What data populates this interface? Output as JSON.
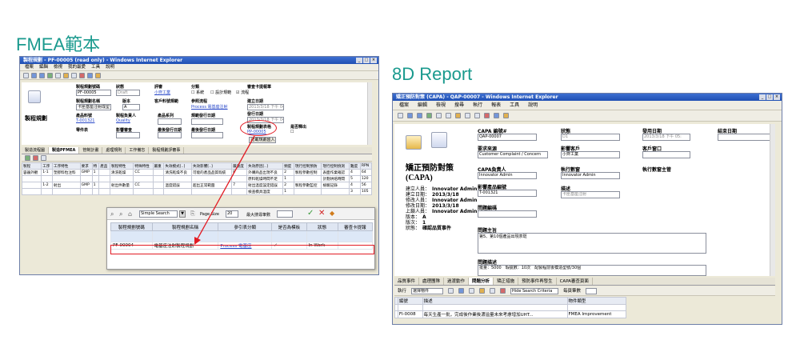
{
  "headings": {
    "left": "FMEA範本",
    "right": "8D Report"
  },
  "fmea": {
    "window_title": "製程規劃 - PF-00005 (read only) - Windows Internet Explorer",
    "menu": [
      "檔案",
      "編輯",
      "檢視",
      "我的最愛",
      "工具",
      "說明"
    ],
    "form_title": "製程規劃",
    "fields": {
      "plan_no_label": "製程規劃號碼",
      "plan_no": "PF-00005",
      "status_label": "狀態",
      "status": "Draft",
      "review_label": "評審",
      "review": "小齊工業",
      "type_label": "分類",
      "type_opts": [
        "系統",
        "設計規範",
        "流程"
      ],
      "review_date_label": "審查卡提報單",
      "plan_name_label": "製程規劃名稱",
      "plan_name": "卡匣基座注射成型",
      "version_label": "版本",
      "version": "A",
      "cust_label": "客戶料號規範",
      "process_label": "參照流程",
      "process": "Process 電基座注射",
      "created_label": "建立日期",
      "created": "2013/3/18 下午 04:31",
      "part_no_label": "產品料號",
      "part_no": "T-001321",
      "owner_label": "製程負責人",
      "owner": "Quality",
      "product_label": "產品系列",
      "approved_label": "規範發行日期",
      "approver_label": "發行日期",
      "approver": "2013/3/18 下午 04:31",
      "partner_label": "零件表",
      "impact_label": "影響審查",
      "revision_label": "最後發行日期",
      "sheet_label": "製程規劃表格",
      "sheet_link": "PP-00005",
      "evaluate_label": "是否釋出",
      "button": "記載規劃匯入"
    },
    "tabs": [
      "製造流程圖",
      "製造PFMEA",
      "管制計畫",
      "處理規則",
      "工作備忘",
      "製程規劃評審事"
    ],
    "table": {
      "headers": [
        "製程",
        "工序",
        "工序特性",
        "要求",
        "特",
        "產品",
        "製程特性",
        "特殊特性",
        "嚴重",
        "失效模式[..]",
        "失效影響[..]",
        "嚴重度",
        "失效原因[..]",
        "頻度",
        "現行控制預防",
        "現行控制偵測",
        "難度",
        "RPN"
      ],
      "rows": [
        [
          "容器外觀",
          "1-1",
          "塑膠料粒注料",
          "GMP",
          "1",
          "",
          "清洗乾燥",
          "CC",
          "",
          "清洗乾燥不良",
          "可能的產品品質瑕疵",
          "8",
          "外購商品出現不良",
          "2",
          "製程參數控制",
          "表面作業確認",
          "4",
          "64"
        ],
        [
          "",
          "",
          "",
          "",
          "",
          "",
          "",
          "",
          "",
          "",
          "",
          "",
          "原料乾燥時間不足",
          "1",
          "",
          "計劃烘焙時間",
          "5",
          "120"
        ],
        [
          "",
          "1-2",
          "射出",
          "GMP",
          "1",
          "",
          "射出件數量",
          "CC",
          "",
          "溫度錯誤",
          "超出正常範圍",
          "7",
          "射出溫度設定錯誤",
          "2",
          "製程參數監控",
          "檢驗記錄",
          "4",
          "56"
        ],
        [
          "",
          "",
          "",
          "",
          "",
          "",
          "",
          "",
          "",
          "",
          "",
          "",
          "檢查模具溫度",
          "1",
          "",
          "",
          "3",
          "105"
        ]
      ]
    },
    "zoom": {
      "search_mode": "Simple Search",
      "page_size_label": "Page Size",
      "page_size": "20",
      "max_label": "最大搜尋筆數",
      "headers": [
        "製程規劃號碼",
        "製程規劃名稱",
        "參引表分類",
        "是否為模板",
        "狀態",
        "審查卡提報"
      ],
      "row": [
        "PF-00004",
        "電基座注射製程規劃",
        "Process 電基座",
        "✓",
        "In Work",
        ""
      ]
    }
  },
  "capa": {
    "window_title": "矯正預防對策 (CAPA) - QAP-00007 - Windows Internet Explorer",
    "menu": [
      "檔案",
      "編輯",
      "檢視",
      "搜尋",
      "執行",
      "報表",
      "工具",
      "說明"
    ],
    "form_title": "矯正預防對策\n(CAPA)",
    "fields": {
      "no_label": "CAPA 編號#",
      "no": "QAP-00007",
      "status_label": "狀態",
      "status": "D1",
      "date_label": "發用日期",
      "date": "2013/3/18 下午 05:",
      "close_label": "結束日期",
      "src_label": "要求來源",
      "src": "Customer Complaint / Concern",
      "customer_label": "影響客戶",
      "customer": "小齊工業",
      "window_label": "客戶窗口",
      "owner_label": "CAPA負責人",
      "owner": "Innovator Admin",
      "exec_label": "執行數窗",
      "exec": "Innovator Admin",
      "exec_owner_label": "執行數窗主管",
      "product_label": "影響產品編號",
      "product": "T-001321",
      "desc_label": "描述",
      "desc": "卡匣基座注射",
      "problem_label": "問題編碼",
      "focus_label": "問題主旨",
      "focus": "第5、第10個產品出現茶斑",
      "problem_desc_label": "問題描述",
      "problem_desc": "批量：5000　瑕疵數：10次　配製程前後模造型號/30個",
      "meta": [
        [
          "建立人員：",
          "Innovator Admin"
        ],
        [
          "建立日期：",
          "2013/3/18"
        ],
        [
          "修改人員：",
          "Innovator Admin"
        ],
        [
          "修改日期：",
          "2013/3/18"
        ],
        [
          "上鎖人員：",
          "Innovator Admin"
        ],
        [
          "版本：",
          "A"
        ],
        [
          "版次：",
          "1"
        ],
        [
          "狀態：",
          "確認品質事件"
        ]
      ]
    },
    "tabs": [
      "品質事件",
      "處理團隊",
      "過渡動作",
      "問題分析",
      "矯正措施",
      "預防事件再發生",
      "CAPA審查頁面"
    ],
    "toolbar": {
      "action_label": "執行",
      "select_label": "選擇物件",
      "search_mode": "Hide Search Criteria",
      "per_page": "每頁筆數"
    },
    "table": {
      "headers": [
        "",
        "編號",
        "描述",
        "物件類型"
      ],
      "rows": [
        [
          "",
          "FI-0008",
          "每天生產一批，完成後作業後濃溢量未來考慮增加UHT...",
          "FMEA Improvement"
        ]
      ]
    }
  }
}
